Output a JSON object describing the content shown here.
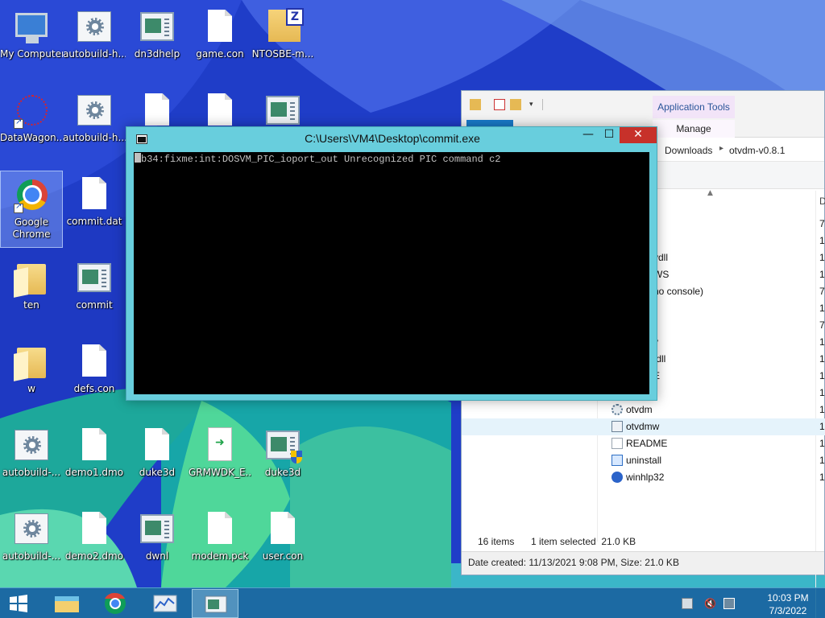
{
  "desktop": {
    "icons": [
      {
        "label": "My Computer",
        "icon": "computer-icon"
      },
      {
        "label": "autobuild-h...",
        "icon": "settings-file-icon"
      },
      {
        "label": "dn3dhelp",
        "icon": "application-window-icon"
      },
      {
        "label": "game.con",
        "icon": "document-icon"
      },
      {
        "label": "NTOSBE-m...",
        "icon": "zip-archive-icon"
      },
      {
        "label": "DataWagon...",
        "icon": "molecule-shortcut-icon"
      },
      {
        "label": "autobuild-h...",
        "icon": "settings-file-icon"
      },
      {
        "label": "Google Chrome",
        "icon": "chrome-shortcut-icon"
      },
      {
        "label": "commit.dat",
        "icon": "document-icon"
      },
      {
        "label": "ten",
        "icon": "folder-icon"
      },
      {
        "label": "commit",
        "icon": "application-window-icon"
      },
      {
        "label": "w",
        "icon": "folder-icon"
      },
      {
        "label": "defs.con",
        "icon": "document-icon"
      },
      {
        "label": "autobuild-...",
        "icon": "settings-file-icon"
      },
      {
        "label": "demo1.dmo",
        "icon": "document-icon"
      },
      {
        "label": "duke3d",
        "icon": "document-icon"
      },
      {
        "label": "GRMWDK_E...",
        "icon": "executable-icon"
      },
      {
        "label": "duke3d",
        "icon": "application-shield-icon"
      },
      {
        "label": "autobuild-...",
        "icon": "settings-file-icon"
      },
      {
        "label": "demo2.dmo",
        "icon": "document-icon"
      },
      {
        "label": "dwnl",
        "icon": "application-window-icon"
      },
      {
        "label": "modem.pck",
        "icon": "document-icon"
      },
      {
        "label": "user.con",
        "icon": "document-icon"
      }
    ]
  },
  "explorer": {
    "context_tab": "Application Tools",
    "manage_tab": "Manage",
    "breadcrumb": [
      "Downloads",
      "otvdm-v0.8.1"
    ],
    "column_header_partial": "D",
    "partial_rows": [
      {
        "name_fragment": "",
        "date_fragment": "7,"
      },
      {
        "name_fragment": "",
        "date_fragment": "1"
      },
      {
        "name_fragment": "vdll",
        "date_fragment": "1"
      },
      {
        "name_fragment": "WS",
        "date_fragment": "1"
      },
      {
        "name_fragment": "no console)",
        "date_fragment": "7,"
      },
      {
        "name_fragment": "",
        "date_fragment": "1"
      },
      {
        "name_fragment": "",
        "date_fragment": "7,"
      },
      {
        "name_fragment": "v",
        "date_fragment": "1"
      },
      {
        "name_fragment": ".dll",
        "date_fragment": "1"
      },
      {
        "name_fragment": "E",
        "date_fragment": "1"
      },
      {
        "name_fragment": "",
        "date_fragment": "1"
      }
    ],
    "files": [
      {
        "name": "otvdm",
        "date_fragment": "1",
        "icon": "gear-file-icon"
      },
      {
        "name": "otvdmw",
        "date_fragment": "1",
        "icon": "window-app-icon"
      },
      {
        "name": "README",
        "date_fragment": "1",
        "icon": "text-file-icon"
      },
      {
        "name": "uninstall",
        "date_fragment": "1",
        "icon": "setup-file-icon"
      },
      {
        "name": "winhlp32",
        "date_fragment": "1",
        "icon": "help-file-icon"
      }
    ],
    "status": {
      "items": "16 items",
      "selected": "1 item selected  21.0 KB"
    },
    "details": "Date created: 11/13/2021 9:08 PM, Size: 21.0 KB"
  },
  "console": {
    "title": "C:\\Users\\VM4\\Desktop\\commit.exe",
    "output_line": "b34:fixme:int:DOSVM_PIC_ioport_out Unrecognized PIC command c2",
    "minimize": "—",
    "maximize": "☐",
    "close": "✕"
  },
  "taskbar": {
    "time": "10:03 PM",
    "date": "7/3/2022"
  },
  "colors": {
    "console_frame": "#68cedd",
    "close_button": "#c7312a",
    "taskbar": "#1c6ea0",
    "selected_row": "#e5f3fb"
  }
}
